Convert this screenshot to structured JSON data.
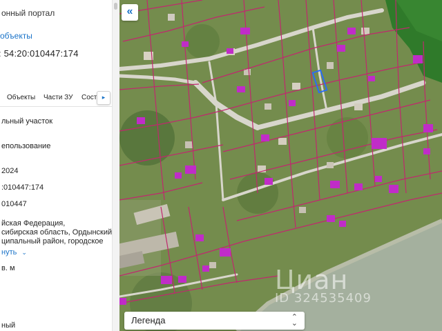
{
  "panel": {
    "portal_title": "онный портал",
    "objects_link": "объекты",
    "cadastral_number": ": 54:20:010447:174",
    "tabs": [
      {
        "label": "Объекты"
      },
      {
        "label": "Части ЗУ"
      },
      {
        "label": "Сост"
      }
    ],
    "info": {
      "object_type": "льный участок",
      "land_use": "епользование",
      "year": "2024",
      "number_full": ":010447:174",
      "quarter": "010447",
      "address_line1": "йская Федерация,",
      "address_line2": "сибирская область, Ордынский",
      "address_line3": "ципальный район, городское",
      "show_more": "нуть",
      "area_unit": "в. м",
      "bottom": "ный"
    }
  },
  "map": {
    "collapse_icon": "double-chevron-left-icon",
    "legend_label": "Легенда",
    "watermark": {
      "logo": "Циан",
      "id": "ID 324535409"
    },
    "colors": {
      "parcel_border": "#c0286e",
      "parcel_fill": "#c02cc8",
      "selected_parcel": "#2a6df4",
      "road": "#dcdcd6",
      "river": "#a4b09e",
      "forest": "#2f7a2a"
    }
  }
}
